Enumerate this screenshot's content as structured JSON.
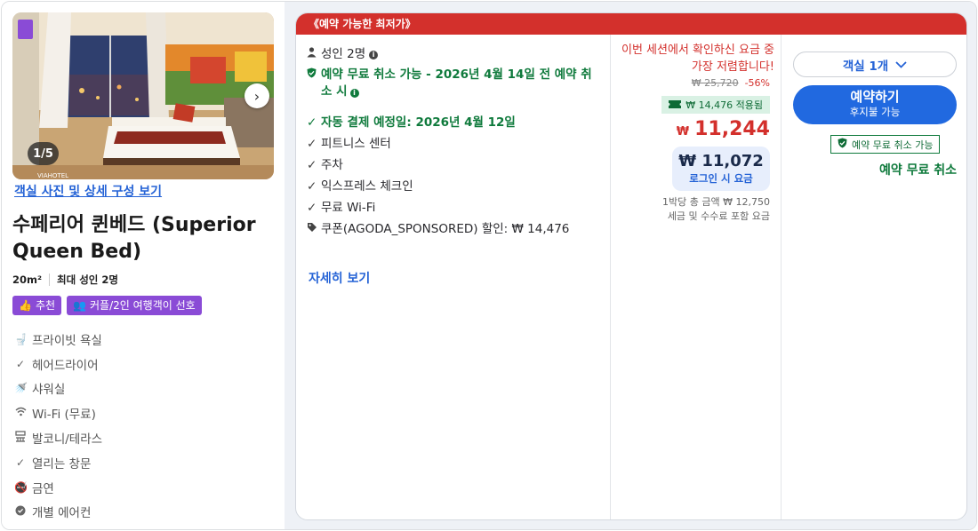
{
  "photo": {
    "counter": "1/5",
    "watermark": "VIAHOTEL"
  },
  "room": {
    "photo_link": "객실 사진 및 상세 구성 보기",
    "title": "수페리어 퀸베드 (Superior Queen Bed)",
    "size": "20m²",
    "max_guests": "최대 성인 2명",
    "tags": [
      {
        "label": "추천",
        "icon": "thumbs-up-icon"
      },
      {
        "label": "커플/2인 여행객이 선호",
        "icon": "couple-icon"
      }
    ],
    "amenities": [
      {
        "label": "프라이빗 욕실",
        "icon": "toilet-icon"
      },
      {
        "label": "헤어드라이어",
        "icon": "check-icon"
      },
      {
        "label": "샤워실",
        "icon": "shower-icon"
      },
      {
        "label": "Wi-Fi (무료)",
        "icon": "wifi-icon"
      },
      {
        "label": "발코니/테라스",
        "icon": "balcony-icon"
      },
      {
        "label": "열리는 창문",
        "icon": "check-icon"
      },
      {
        "label": "금연",
        "icon": "no-smoking-icon"
      },
      {
        "label": "개별 에어컨",
        "icon": "aircon-icon"
      }
    ]
  },
  "offer": {
    "header": "《예약 가능한 최저가》",
    "guests": "성인 2명",
    "free_cancel": "예약 무료 취소 가능 - 2026년 4월 14일 전 예약 취소 시",
    "auto_pay": "자동 결제 예정일: 2026년 4월 12일",
    "features": [
      "피트니스 센터",
      "주차",
      "익스프레스 체크인",
      "무료 Wi-Fi"
    ],
    "coupon": "쿠폰(AGODA_SPONSORED) 할인: ₩ 14,476",
    "more_link": "자세히 보기"
  },
  "price": {
    "session_msg": "이번 세션에서 확인하신 요금 중 가장 저렴합니다!",
    "original": "₩ 25,720",
    "discount": "-56%",
    "applied": "₩ 14,476 적용됨",
    "currency": "₩",
    "amount": "11,244",
    "login_price": "₩ 11,072",
    "login_label": "로그인 시 요금",
    "total_line": "1박당 총 금액 ₩ 12,750",
    "tax_line": "세금 및 수수료 포함 요금"
  },
  "booking": {
    "room_count": "객실 1개",
    "book_label": "예약하기",
    "book_sub": "후지불 가능",
    "badge": "예약 무료 취소 가능",
    "free_cancel_text": "예약 무료 취소"
  },
  "colors": {
    "accent_red": "#d3302c",
    "accent_blue": "#2169e0",
    "accent_green": "#0f7a3c",
    "tag_purple": "#8a4bd6"
  }
}
